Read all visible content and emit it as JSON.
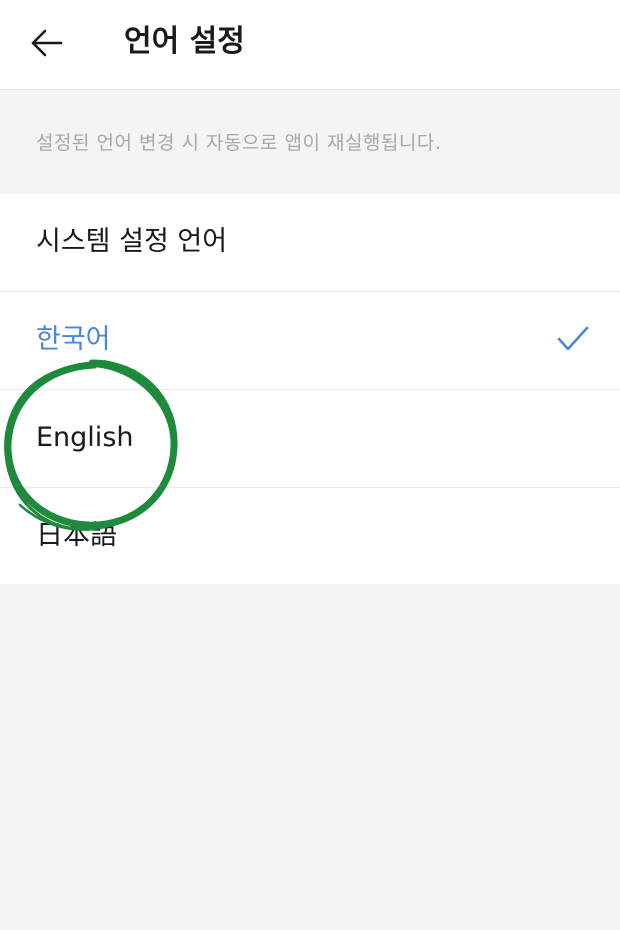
{
  "header": {
    "back_icon": "arrow-left-icon",
    "title": "언어 설정"
  },
  "notice": {
    "text": "설정된 언어 변경 시 자동으로 앱이 재실행됩니다."
  },
  "languages": [
    {
      "label": "시스템 설정 언어",
      "selected": false
    },
    {
      "label": "한국어",
      "selected": true
    },
    {
      "label": "English",
      "selected": false
    },
    {
      "label": "日本語",
      "selected": false
    }
  ],
  "colors": {
    "accent": "#4a87d6",
    "annotation": "#1e8a3c",
    "background": "#f4f4f4"
  },
  "icons": {
    "check": "check-icon"
  }
}
